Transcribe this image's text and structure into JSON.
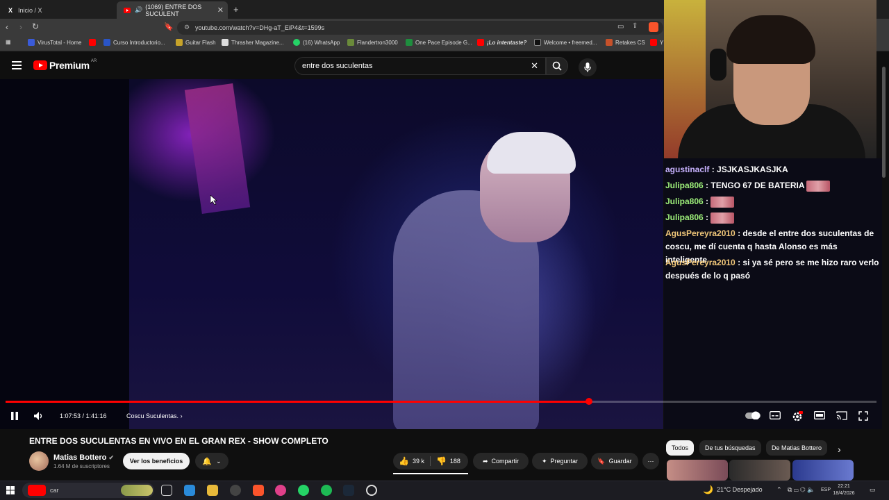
{
  "browser": {
    "tabs": [
      {
        "label": "Inicio / X",
        "icon": "x-logo-icon",
        "active": false
      },
      {
        "label": "(1069) ENTRE DOS SUCULENT",
        "icon": "youtube-icon",
        "active": true
      }
    ],
    "url": "youtube.com/watch?v=DHg-aT_EiP4&t=1599s",
    "bookmarks": [
      "VirusTotal - Home",
      "Curso Introductorio...",
      "Guitar Flash",
      "Thrasher Magazine...",
      "(16) WhatsApp",
      "Flandertron3000",
      "One Pace Episode G...",
      "¡Lo intentaste?",
      "Welcome • freemed...",
      "Retakes CS",
      "Y"
    ]
  },
  "youtube": {
    "logo": "Premium",
    "region": "AR",
    "search": "entre dos suculentas"
  },
  "player": {
    "time": "1:07:53 / 1:41:16",
    "chapter": "Coscu Suculentas.",
    "progress": 0.67
  },
  "chat": [
    {
      "user": "agustinaclf",
      "color": "#c8b2ff",
      "text": " : JSJKASJKASJKA",
      "emotes": 0
    },
    {
      "user": "Julipa806",
      "color": "#9ef07a",
      "text": " : TENGO 67 DE BATERIA",
      "emotes": 1
    },
    {
      "user": "Julipa806",
      "color": "#9ef07a",
      "text": " : ",
      "emotes": 1
    },
    {
      "user": "Julipa806",
      "color": "#9ef07a",
      "text": " : ",
      "emotes": 1
    },
    {
      "user": "AgusPereyra2010",
      "color": "#f2c87a",
      "text": " : desde el entre dos suculentas de coscu, me dí cuenta q hasta Alonso es más inteligente",
      "emotes": 0
    },
    {
      "user": "AgusPereyra2010",
      "color": "#f2c87a",
      "text": " : si ya sé pero se me hizo raro verlo después de lo q pasó",
      "emotes": 0
    }
  ],
  "video": {
    "title": "ENTRE DOS SUCULENTAS EN VIVO EN EL GRAN REX - SHOW COMPLETO",
    "channel": "Matias Bottero",
    "subscribers": "1.64 M de suscriptores",
    "benefits": "Ver los beneficios",
    "likes": "39 k",
    "dislikes": "188",
    "share": "Compartir",
    "ask": "Preguntar",
    "save": "Guardar"
  },
  "chips": [
    "Todos",
    "De tus búsquedas",
    "De Matias Bottero"
  ],
  "taskbar": {
    "search_placeholder": "car",
    "weather": "21°C  Despejado",
    "lang": "ESP",
    "time": "22:21",
    "date": "18/4/2026"
  },
  "colors": {
    "youtube_red": "#ff0000",
    "accent": "#f2c87a"
  }
}
